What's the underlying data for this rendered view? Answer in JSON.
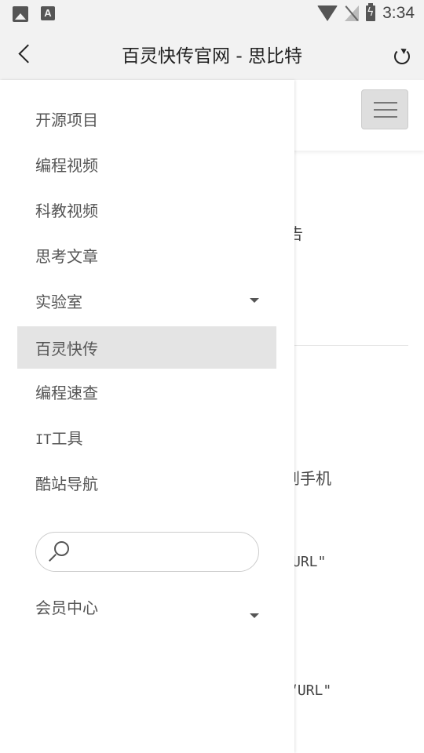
{
  "status_bar": {
    "time": "3:34",
    "left_icons": [
      "gallery-icon",
      "font-icon"
    ],
    "right_icons": [
      "wifi-icon",
      "no-signal-icon",
      "battery-charging-icon"
    ]
  },
  "title_bar": {
    "title": "百灵快传官网 - 思比特",
    "back_icon": "chevron-left-icon",
    "refresh_icon": "refresh-icon"
  },
  "drawer": {
    "items": [
      {
        "label": "开源项目"
      },
      {
        "label": "编程视频"
      },
      {
        "label": "科教视频"
      },
      {
        "label": "思考文章"
      },
      {
        "label": "实验室",
        "has_dropdown": true
      },
      {
        "label": "百灵快传",
        "active": true
      },
      {
        "label": "编程速查"
      },
      {
        "label_prefix": "IT",
        "label": "工具"
      },
      {
        "label": "酷站导航"
      }
    ],
    "search": {
      "value": "",
      "placeholder": ""
    },
    "member_center": {
      "label": "会员中心",
      "has_dropdown": true
    }
  },
  "background_page": {
    "fragment_1": "告",
    "fragment_2": "到手机",
    "fragment_3": "URL\"",
    "fragment_4": "“URL\""
  },
  "colors": {
    "active_item_bg": "#e4e4e4",
    "bar_bg": "#f2f2f2",
    "hamburger_bg": "#dedede"
  }
}
